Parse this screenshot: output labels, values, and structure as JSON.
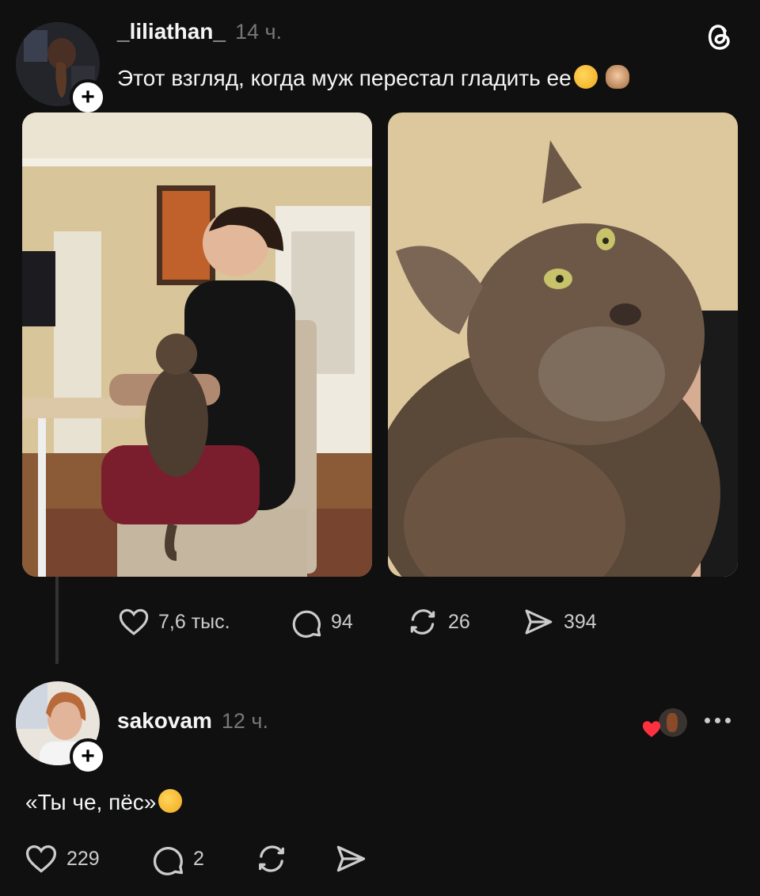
{
  "post": {
    "username": "_liliathan_",
    "time": "14 ч.",
    "text": "Этот взгляд, когда муж перестал гладить ее",
    "emojis": [
      "rolling-on-floor-laughing",
      "see-no-evil-monkey"
    ],
    "actions": {
      "likes": "7,6 тыс.",
      "comments": "94",
      "reposts": "26",
      "shares": "394"
    }
  },
  "reply": {
    "username": "sakovam",
    "time": "12 ч.",
    "text": "«Ты че, пёс»",
    "emojis": [
      "rolling-on-floor-laughing"
    ],
    "actions": {
      "likes": "229",
      "comments": "2"
    }
  },
  "icons": {
    "app": "threads-logo-icon",
    "like": "heart-icon",
    "comment": "comment-bubble-icon",
    "repost": "repost-icon",
    "share": "send-icon",
    "more": "more-dots-icon",
    "liked_by_author": "liked-by-author-icon"
  },
  "colors": {
    "background": "#101010",
    "text": "#f3f5f7",
    "secondary": "#777777",
    "heart_red": "#ff3040"
  }
}
